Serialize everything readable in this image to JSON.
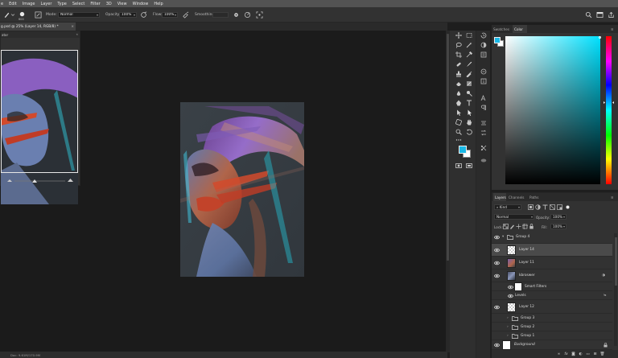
{
  "menu": [
    "e",
    "Edit",
    "Image",
    "Layer",
    "Type",
    "Select",
    "Filter",
    "3D",
    "View",
    "Window",
    "Help"
  ],
  "options_bar": {
    "mode_label": "Mode:",
    "mode_value": "Normal",
    "opacity_label": "Opacity:",
    "opacity_value": "100%",
    "flow_label": "Flow:",
    "flow_value": "100%",
    "smoothing_label": "Smoothing:",
    "smoothing_value": "",
    "brush_size": "600"
  },
  "document_tab": {
    "title": "g.psd @ 25% (Layer 14, RGB/8) *",
    "close": "×"
  },
  "navigator": {
    "title": "ator",
    "dock": "«"
  },
  "status_bar": {
    "doc_info": "Doc: 9.61M/170.9M"
  },
  "color_panel": {
    "tabs": [
      "Swatches",
      "Color"
    ],
    "active_tab": "Color",
    "foreground": "#1ab8e6",
    "background": "#ffffff"
  },
  "layers_panel": {
    "tabs": [
      "Layers",
      "Channels",
      "Paths"
    ],
    "active_tab": "Layers",
    "filter_kind": "Kind",
    "blend_mode": "Normal",
    "opacity_label": "Opacity:",
    "opacity_value": "100%",
    "lock_label": "Lock:",
    "fill_label": "Fill:",
    "fill_value": "100%",
    "layers": [
      {
        "name": "Group 4",
        "type": "group",
        "visible": true,
        "expanded": true,
        "indent": 0
      },
      {
        "name": "Layer 14",
        "type": "layer",
        "visible": true,
        "selected": true,
        "indent": 1
      },
      {
        "name": "Layer 11",
        "type": "image",
        "visible": true,
        "indent": 1
      },
      {
        "name": "kbroswer",
        "type": "smart",
        "visible": true,
        "indent": 1
      },
      {
        "name": "Smart Filters",
        "type": "filters",
        "visible": true,
        "indent": 2
      },
      {
        "name": "Levels",
        "type": "filter",
        "visible": true,
        "indent": 2
      },
      {
        "name": "Layer 12",
        "type": "layer",
        "visible": true,
        "indent": 1
      },
      {
        "name": "Group 3",
        "type": "group",
        "visible": false,
        "expanded": false,
        "indent": 1
      },
      {
        "name": "Group 2",
        "type": "group",
        "visible": false,
        "expanded": false,
        "indent": 1
      },
      {
        "name": "Group 1",
        "type": "group",
        "visible": false,
        "expanded": false,
        "indent": 1
      },
      {
        "name": "Background",
        "type": "background",
        "visible": true,
        "indent": 0
      }
    ]
  }
}
